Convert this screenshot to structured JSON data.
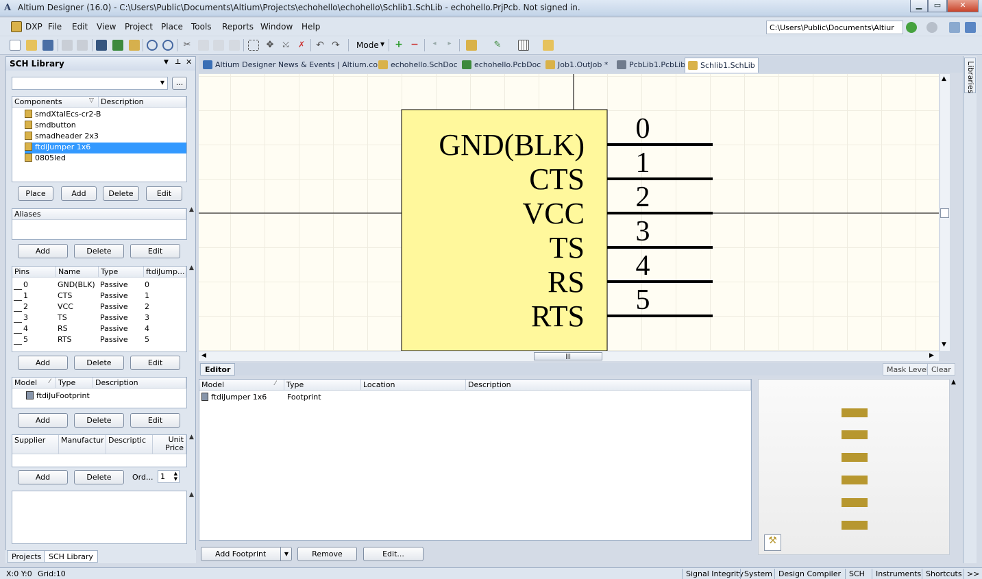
{
  "window": {
    "title": "Altium Designer (16.0) - C:\\Users\\Public\\Documents\\Altium\\Projects\\echohello\\echohello\\Schlib1.SchLib - echohello.PrjPcb. Not signed in.",
    "logo": "A"
  },
  "menu": [
    "DXP",
    "File",
    "Edit",
    "View",
    "Project",
    "Place",
    "Tools",
    "Reports",
    "Window",
    "Help"
  ],
  "path_field": "C:\\Users\\Public\\Documents\\Altiur",
  "toolbar": {
    "mode_label": "Mode"
  },
  "panel": {
    "title": "SCH Library",
    "filter_browse": "...",
    "components": {
      "headers": [
        "Components",
        "Description"
      ],
      "items": [
        "smdXtalEcs-cr2-B",
        "smdbutton",
        "smadheader 2x3",
        "ftdiJumper 1x6",
        "0805led"
      ],
      "selected": 3,
      "buttons": [
        "Place",
        "Add",
        "Delete",
        "Edit"
      ]
    },
    "aliases": {
      "header": "Aliases",
      "buttons": [
        "Add",
        "Delete",
        "Edit"
      ]
    },
    "pins": {
      "headers": [
        "Pins",
        "Name",
        "Type",
        "ftdiJump..."
      ],
      "rows": [
        [
          "0",
          "GND(BLK)",
          "Passive",
          "0"
        ],
        [
          "1",
          "CTS",
          "Passive",
          "1"
        ],
        [
          "2",
          "VCC",
          "Passive",
          "2"
        ],
        [
          "3",
          "TS",
          "Passive",
          "3"
        ],
        [
          "4",
          "RS",
          "Passive",
          "4"
        ],
        [
          "5",
          "RTS",
          "Passive",
          "5"
        ]
      ],
      "buttons": [
        "Add",
        "Delete",
        "Edit"
      ]
    },
    "models": {
      "headers": [
        "Model",
        "Type",
        "Description"
      ],
      "row": [
        "ftdiJu",
        "Footprint",
        ""
      ],
      "buttons": [
        "Add",
        "Delete",
        "Edit"
      ]
    },
    "suppliers": {
      "headers": [
        "Supplier",
        "Manufactur",
        "Descriptic",
        "Unit Price"
      ],
      "buttons": [
        "Add",
        "Delete"
      ],
      "order_label": "Ord...",
      "order_value": "1"
    }
  },
  "doc_tabs": [
    {
      "label": "Altium Designer News & Events | Altium.com",
      "icon_color": "#3a6fb5"
    },
    {
      "label": "echohello.SchDoc",
      "icon_color": "#d9b24a"
    },
    {
      "label": "echohello.PcbDoc",
      "icon_color": "#3c8a3c"
    },
    {
      "label": "Job1.OutJob *",
      "icon_color": "#d9b24a"
    },
    {
      "label": "PcbLib1.PcbLib",
      "icon_color": "#707b8c"
    },
    {
      "label": "Schlib1.SchLib",
      "icon_color": "#d9b24a"
    }
  ],
  "active_tab": 5,
  "schematic": {
    "pins": [
      {
        "num": "0",
        "name": "GND(BLK)"
      },
      {
        "num": "1",
        "name": "CTS"
      },
      {
        "num": "2",
        "name": "VCC"
      },
      {
        "num": "3",
        "name": "TS"
      },
      {
        "num": "4",
        "name": "RS"
      },
      {
        "num": "5",
        "name": "RTS"
      }
    ],
    "body_color": "#fff89c"
  },
  "editor": {
    "label": "Editor",
    "mask_level": "Mask Level",
    "clear": "Clear",
    "headers": [
      "Model",
      "Type",
      "Location",
      "Description"
    ],
    "rows": [
      [
        "ftdiJumper 1x6",
        "Footprint",
        "",
        ""
      ]
    ],
    "add_footprint": "Add Footprint",
    "remove": "Remove",
    "edit": "Edit..."
  },
  "right_strip": "Libraries",
  "bottom_tabs": [
    "Projects",
    "SCH Library"
  ],
  "status": {
    "coords": "X:0 Y:0",
    "grid": "Grid:10",
    "buttons": [
      "Signal Integrity",
      "System",
      "Design Compiler",
      "SCH",
      "Instruments",
      "Shortcuts",
      ">>"
    ]
  }
}
